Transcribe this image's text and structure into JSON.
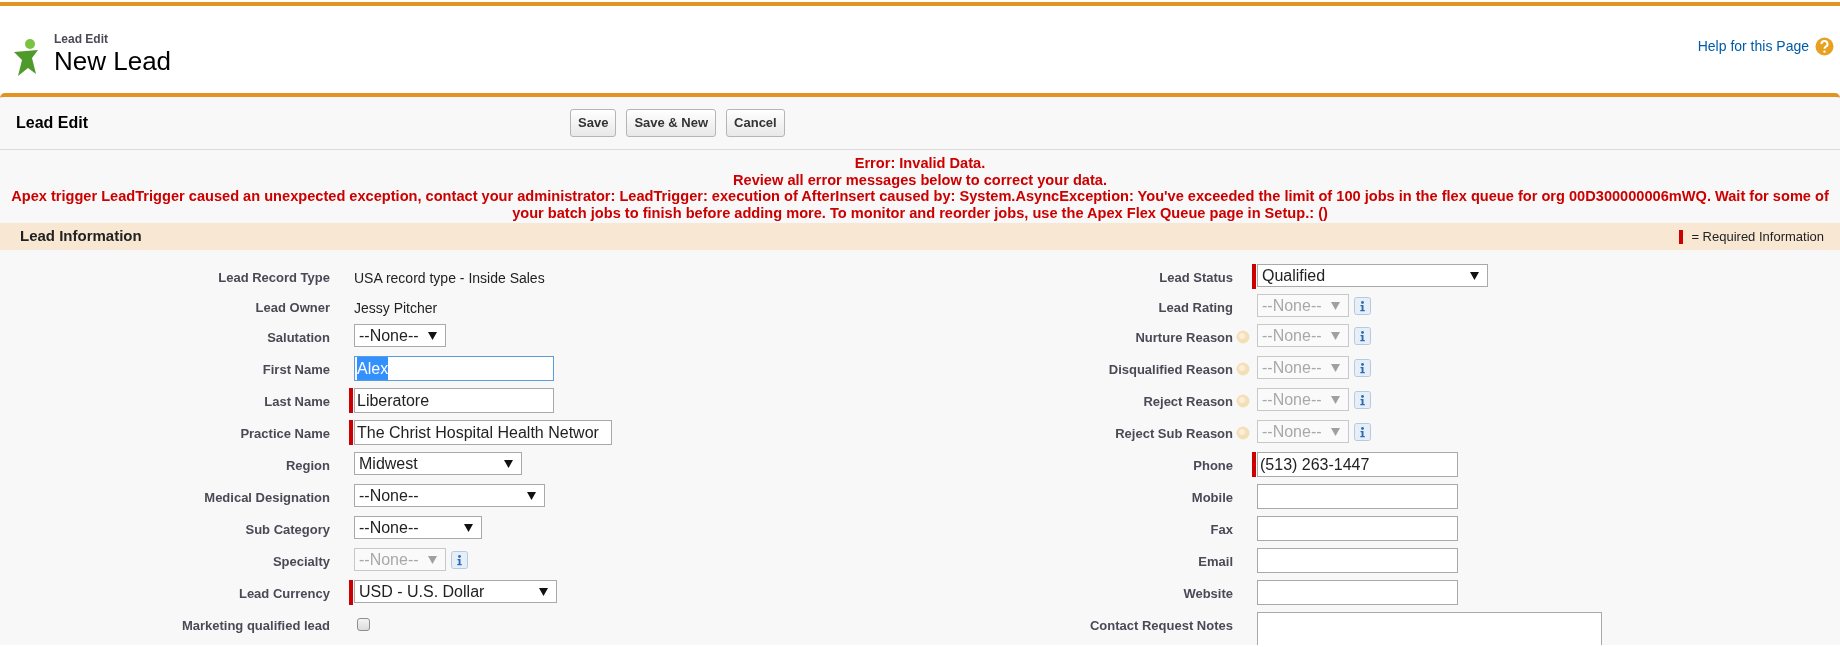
{
  "page_header": {
    "breadcrumb": "Lead Edit",
    "title": "New Lead",
    "help_link": "Help for this Page"
  },
  "edit_panel": {
    "title": "Lead Edit",
    "buttons": [
      "Save",
      "Save & New",
      "Cancel"
    ]
  },
  "errors": [
    "Error: Invalid Data.",
    "Review all error messages below to correct your data.",
    "Apex trigger LeadTrigger caused an unexpected exception, contact your administrator: LeadTrigger: execution of AfterInsert caused by: System.AsyncException: You've exceeded the limit of 100 jobs in the flex queue for org 00D300000006mWQ. Wait for some of your batch jobs to finish before adding more. To monitor and reorder jobs, use the Apex Flex Queue page in Setup.: ()"
  ],
  "section": {
    "title": "Lead Information",
    "required_legend": "= Required Information"
  },
  "left_fields": [
    {
      "label": "Lead Record Type",
      "kind": "text",
      "value": "USA record type - Inside Sales"
    },
    {
      "label": "Lead Owner",
      "kind": "text",
      "value": "Jessy Pitcher"
    },
    {
      "label": "Salutation",
      "kind": "select",
      "value": "--None--",
      "required": false,
      "disabled": false,
      "info": false
    },
    {
      "label": "First Name",
      "kind": "input",
      "value": "Alex",
      "required": false,
      "focused": true
    },
    {
      "label": "Last Name",
      "kind": "input",
      "value": "Liberatore",
      "required": true,
      "focused": false
    },
    {
      "label": "Practice Name",
      "kind": "input",
      "value": "The Christ Hospital Health Networ",
      "required": true,
      "focused": false
    },
    {
      "label": "Region",
      "kind": "select",
      "value": "Midwest",
      "required": false,
      "disabled": false,
      "info": false
    },
    {
      "label": "Medical Designation",
      "kind": "select",
      "value": "--None--",
      "required": false,
      "disabled": false,
      "info": false
    },
    {
      "label": "Sub Category",
      "kind": "select",
      "value": "--None--",
      "required": false,
      "disabled": false,
      "info": false
    },
    {
      "label": "Specialty",
      "kind": "select",
      "value": "--None--",
      "required": false,
      "disabled": true,
      "info": true
    },
    {
      "label": "Lead Currency",
      "kind": "select",
      "value": "USD - U.S. Dollar",
      "required": true,
      "disabled": false,
      "info": false
    },
    {
      "label": "Marketing qualified lead",
      "kind": "checkbox",
      "checked": false
    }
  ],
  "right_fields": [
    {
      "label": "Lead Status",
      "kind": "select",
      "value": "Qualified",
      "required": true,
      "disabled": false,
      "info": false,
      "help": false
    },
    {
      "label": "Lead Rating",
      "kind": "select",
      "value": "--None--",
      "required": false,
      "disabled": true,
      "info": true,
      "help": false
    },
    {
      "label": "Nurture Reason",
      "kind": "select",
      "value": "--None--",
      "required": false,
      "disabled": true,
      "info": true,
      "help": true
    },
    {
      "label": "Disqualified Reason",
      "kind": "select",
      "value": "--None--",
      "required": false,
      "disabled": true,
      "info": true,
      "help": true
    },
    {
      "label": "Reject Reason",
      "kind": "select",
      "value": "--None--",
      "required": false,
      "disabled": true,
      "info": true,
      "help": true
    },
    {
      "label": "Reject Sub Reason",
      "kind": "select",
      "value": "--None--",
      "required": false,
      "disabled": true,
      "info": true,
      "help": true
    },
    {
      "label": "Phone",
      "kind": "input",
      "value": "(513) 263-1447",
      "required": true,
      "focused": false
    },
    {
      "label": "Mobile",
      "kind": "input",
      "required": false,
      "focused": false
    },
    {
      "label": "Fax",
      "kind": "input",
      "required": false,
      "focused": false
    },
    {
      "label": "Email",
      "kind": "input",
      "required": false,
      "focused": false
    },
    {
      "label": "Website",
      "kind": "input",
      "required": false,
      "focused": false
    },
    {
      "label": "Contact Request Notes",
      "kind": "textarea",
      "required": false
    }
  ]
}
